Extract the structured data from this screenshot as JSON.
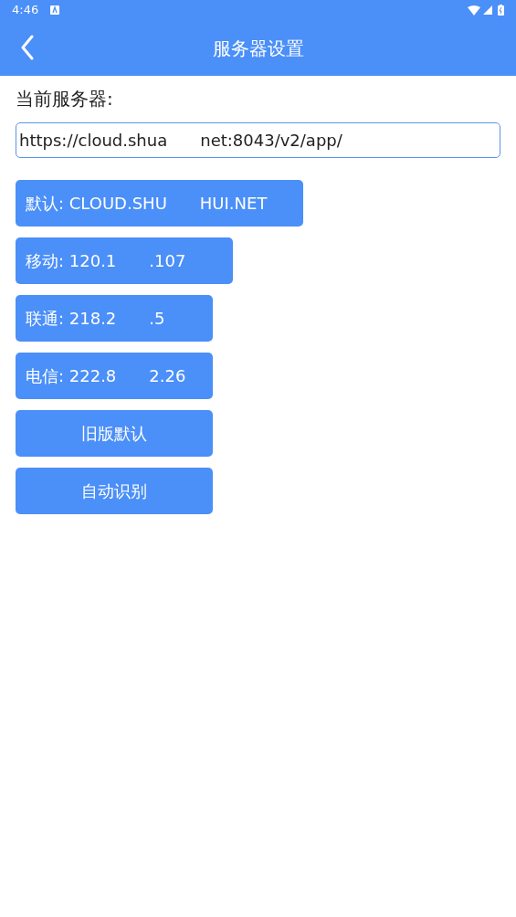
{
  "status_bar": {
    "time": "4:46"
  },
  "toolbar": {
    "title": "服务器设置"
  },
  "current_server": {
    "label": "当前服务器:",
    "value_parts": [
      "https://cloud.shua",
      "net:8043/v2/app/"
    ]
  },
  "buttons": [
    {
      "label_parts": [
        "默认: CLOUD.SHU",
        "HUI.NET"
      ]
    },
    {
      "label_parts": [
        "移动: 120.1",
        ".107"
      ]
    },
    {
      "label_parts": [
        "联通: 218.2",
        ".5"
      ]
    },
    {
      "label_parts": [
        "电信: 222.8",
        "2.26"
      ]
    },
    {
      "label_parts": [
        "旧版默认"
      ]
    },
    {
      "label_parts": [
        "自动识别"
      ]
    }
  ]
}
